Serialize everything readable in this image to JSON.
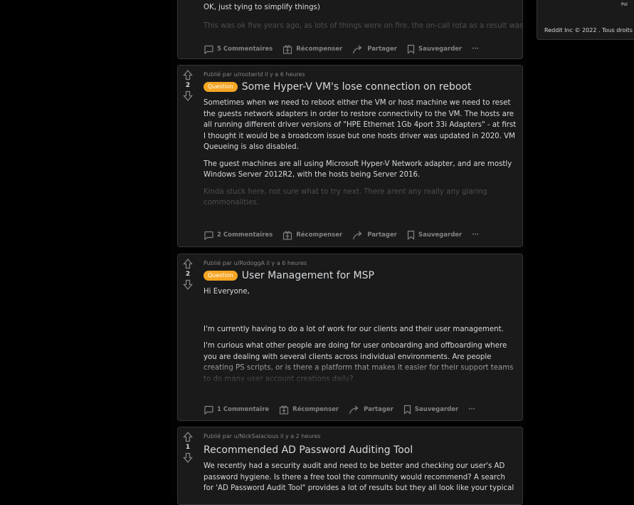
{
  "sidebar": {
    "footer": "Reddit Inc © 2022 . Tous droits",
    "top_text": "Pol"
  },
  "post0": {
    "body": [
      "OK, just tying to simplify things)",
      "This was ok five years ago, as lots of things were on fire, the on-call rota as a result was"
    ],
    "actions": {
      "comments": "5 Commentaires",
      "award": "Récompenser",
      "share": "Partager",
      "save": "Sauvegarder",
      "more": "···"
    }
  },
  "post1": {
    "score": "2",
    "meta": "Publié par u/rootwrld il y a 6 heures",
    "flair": "Question",
    "title": "Some Hyper-V VM's lose connection on reboot",
    "body": [
      "Sometimes when we need to reboot either the VM or host machine we need to reset the guests network adapters in order to restore connectivity to the VM. The hosts are all running different driver versions of \"HPE Ethernet 1Gb 4port 33i Adapters\" - at first I thought it would be a broadcom issue but one hosts driver was updated in 2020. VM Queueing is also disabled.",
      "The guest machines are all using Microsoft Hyper-V Network adapter, and are mostly Windows Server 2012R2, with the hosts being Server 2016.",
      "Kinda stuck here, not sure what to try next. There arent any really any glaring commonalities."
    ],
    "actions": {
      "comments": "2 Commentaires",
      "award": "Récompenser",
      "share": "Partager",
      "save": "Sauvegarder",
      "more": "···"
    }
  },
  "post2": {
    "score": "2",
    "meta": "Publié par u/RodoggA il y a 6 heures",
    "flair": "Question",
    "title": "User Management for MSP",
    "body": [
      "Hi Everyone,",
      "I'm currently having to do a lot of work for our clients and their user management.",
      "I'm curious what other people are doing for user onboarding and offboarding where you are dealing with several clients across individual environments. Are people creating PS scripts, or is there a platform that makes it easier for their support teams to do many user account creations daily?"
    ],
    "actions": {
      "comments": "1 Commentaire",
      "award": "Récompenser",
      "share": "Partager",
      "save": "Sauvegarder",
      "more": "···"
    }
  },
  "post3": {
    "score": "1",
    "meta": "Publié par u/NickSalacious il y a 2 heures",
    "title": "Recommended AD Password Auditing Tool",
    "body": [
      "We recently had a security audit and need to be better and checking our user's AD password hygiene. Is there a free tool the community would recommend? A search for 'AD Password Audit Tool\" provides a lot of results but they all look like your typical"
    ]
  }
}
